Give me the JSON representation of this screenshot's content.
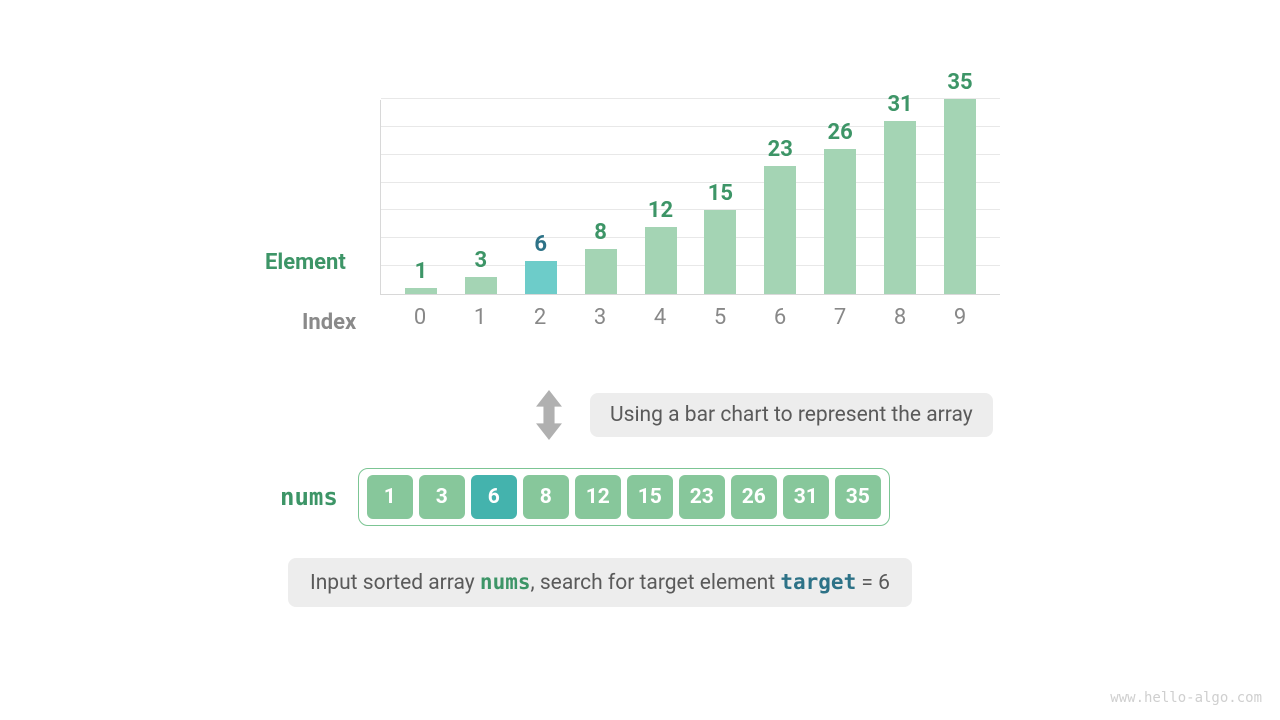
{
  "chart_data": {
    "type": "bar",
    "categories": [
      0,
      1,
      2,
      3,
      4,
      5,
      6,
      7,
      8,
      9
    ],
    "values": [
      1,
      3,
      6,
      8,
      12,
      15,
      23,
      26,
      31,
      35
    ],
    "highlighted_index": 2,
    "ylim": [
      0,
      35
    ],
    "gridlines": [
      5,
      10,
      15,
      20,
      25,
      30,
      35
    ],
    "ylabel": "Element",
    "xlabel": "Index"
  },
  "caption": "Using a bar chart to represent the array",
  "array": {
    "label": "nums",
    "values": [
      1,
      3,
      6,
      8,
      12,
      15,
      23,
      26,
      31,
      35
    ],
    "highlighted_index": 2
  },
  "description": {
    "prefix": "Input sorted array ",
    "array_name": "nums",
    "mid": ", search for target element ",
    "target_name": "target",
    "suffix": " = 6"
  },
  "watermark": "www.hello-algo.com",
  "colors": {
    "bar_normal": "#a4d4b4",
    "bar_highlight": "#6dccc9",
    "cell_normal": "#87c79b",
    "cell_highlight": "#44b3ad",
    "text_green": "#3d9567",
    "text_teal": "#2d7287"
  }
}
